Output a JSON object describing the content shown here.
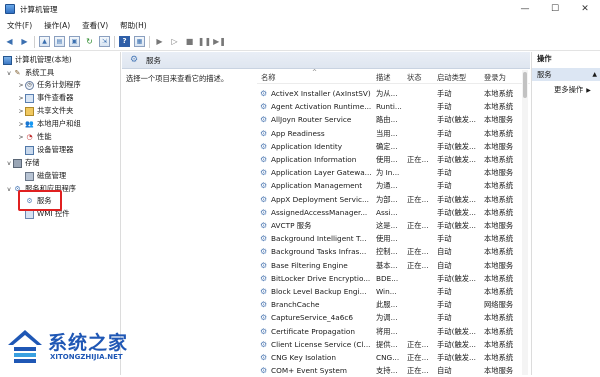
{
  "window": {
    "title": "计算机管理",
    "controls": [
      "—",
      "☐",
      "✕"
    ]
  },
  "menu": [
    "文件(F)",
    "操作(A)",
    "查看(V)",
    "帮助(H)"
  ],
  "tree": {
    "root": "计算机管理(本地)",
    "items": [
      {
        "label": "系统工具",
        "level": 1,
        "expander": "v",
        "icon": "tools-icon"
      },
      {
        "label": "任务计划程序",
        "level": 2,
        "expander": ">",
        "icon": "clock-icon"
      },
      {
        "label": "事件查看器",
        "level": 2,
        "expander": ">",
        "icon": "event-icon"
      },
      {
        "label": "共享文件夹",
        "level": 2,
        "expander": ">",
        "icon": "folder-icon"
      },
      {
        "label": "本地用户和组",
        "level": 2,
        "expander": ">",
        "icon": "users-icon"
      },
      {
        "label": "性能",
        "level": 2,
        "expander": ">",
        "icon": "performance-icon"
      },
      {
        "label": "设备管理器",
        "level": 2,
        "expander": "",
        "icon": "device-manager-icon"
      },
      {
        "label": "存储",
        "level": 1,
        "expander": "v",
        "icon": "storage-icon"
      },
      {
        "label": "磁盘管理",
        "level": 2,
        "expander": "",
        "icon": "disk-icon"
      },
      {
        "label": "服务和应用程序",
        "level": 1,
        "expander": "v",
        "icon": "services-apps-icon"
      },
      {
        "label": "服务",
        "level": 2,
        "expander": "",
        "icon": "gear-icon",
        "selected": true
      },
      {
        "label": "WMI 控件",
        "level": 2,
        "expander": "",
        "icon": "wmi-icon"
      }
    ]
  },
  "center": {
    "title": "服务",
    "description": "选择一个项目来查看它的描述。",
    "columns": [
      "名称",
      "描述",
      "状态",
      "启动类型",
      "登录为"
    ],
    "rows": [
      [
        "ActiveX Installer (AxInstSV)",
        "为从...",
        "",
        "手动",
        "本地系统"
      ],
      [
        "Agent Activation Runtime...",
        "Runti...",
        "",
        "手动",
        "本地系统"
      ],
      [
        "AllJoyn Router Service",
        "路由...",
        "",
        "手动(触发...",
        "本地服务"
      ],
      [
        "App Readiness",
        "当用...",
        "",
        "手动",
        "本地系统"
      ],
      [
        "Application Identity",
        "确定...",
        "",
        "手动(触发...",
        "本地服务"
      ],
      [
        "Application Information",
        "使用...",
        "正在...",
        "手动(触发...",
        "本地系统"
      ],
      [
        "Application Layer Gatewa...",
        "为 In...",
        "",
        "手动",
        "本地服务"
      ],
      [
        "Application Management",
        "为通...",
        "",
        "手动",
        "本地系统"
      ],
      [
        "AppX Deployment Servic...",
        "为部...",
        "正在...",
        "手动(触发...",
        "本地系统"
      ],
      [
        "AssignedAccessManager...",
        "Assi...",
        "",
        "手动(触发...",
        "本地系统"
      ],
      [
        "AVCTP 服务",
        "这是...",
        "正在...",
        "手动(触发...",
        "本地服务"
      ],
      [
        "Background Intelligent T...",
        "使用...",
        "",
        "手动",
        "本地系统"
      ],
      [
        "Background Tasks Infras...",
        "控制...",
        "正在...",
        "自动",
        "本地系统"
      ],
      [
        "Base Filtering Engine",
        "基本...",
        "正在...",
        "自动",
        "本地服务"
      ],
      [
        "BitLocker Drive Encryptio...",
        "BDE...",
        "",
        "手动(触发...",
        "本地系统"
      ],
      [
        "Block Level Backup Engi...",
        "Win...",
        "",
        "手动",
        "本地系统"
      ],
      [
        "BranchCache",
        "此服...",
        "",
        "手动",
        "网络服务"
      ],
      [
        "CaptureService_4a6c6",
        "为调...",
        "",
        "手动",
        "本地系统"
      ],
      [
        "Certificate Propagation",
        "将用...",
        "",
        "手动(触发...",
        "本地系统"
      ],
      [
        "Client License Service (Cl...",
        "提供...",
        "正在...",
        "手动(触发...",
        "本地系统"
      ],
      [
        "CNG Key Isolation",
        "CNG...",
        "正在...",
        "手动(触发...",
        "本地系统"
      ],
      [
        "COM+ Event System",
        "支持...",
        "正在...",
        "自动",
        "本地服务"
      ]
    ]
  },
  "actions": {
    "title": "操作",
    "group": "服务",
    "item": "更多操作"
  },
  "watermark": {
    "brand": "系统之家",
    "url": "XITONGZHIJIA.NET"
  }
}
